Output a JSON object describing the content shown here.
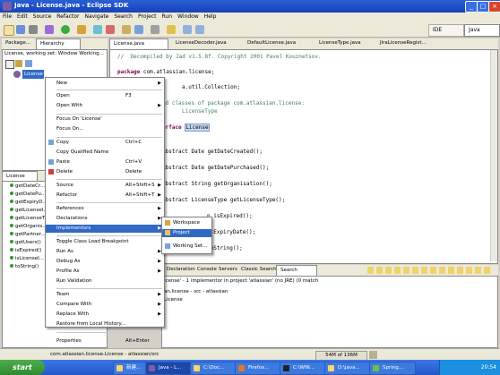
{
  "window": {
    "title": "Java - License.java - Eclipse SDK",
    "buttons": [
      "_",
      "□",
      "×"
    ]
  },
  "menubar": [
    "File",
    "Edit",
    "Source",
    "Refactor",
    "Navigate",
    "Search",
    "Project",
    "Run",
    "Window",
    "Help"
  ],
  "perspectives": {
    "ide": "IDE",
    "java": "Java"
  },
  "left_tabs": {
    "package": "Package...",
    "hierarchy": "Hierarchy"
  },
  "hierarchy": {
    "header": "License, working set: Window Working...",
    "selected_node": "License"
  },
  "outline": {
    "header_label": "License",
    "items": [
      "getDateCr...",
      "getDatePu...",
      "getExpiryD...",
      "getLicenseI...",
      "getLicenseT...",
      "getOrganis...",
      "getPartner...",
      "getUsers()",
      "isExpired()",
      "isLicenseI...",
      "toString()"
    ]
  },
  "editor_tabs": [
    "License.java",
    "LicenseDecoder.java",
    "DefaultLicense.java",
    "LicenseType.java",
    "JiraLicenseRegist..."
  ],
  "code": {
    "line1": "//  Decompiled by Jad v1.5.8f. Copyright 2001 Pavel Kouznetsov.",
    "pkg_kw": "package",
    "pkg_name": " com.atlassian.license;",
    "import_rest": "a.util.Collection;",
    "comment1": "ed classes of package com.atlassian.license:",
    "comment2": "LicenseType",
    "iface_kw": "erface",
    "iface_name": "License",
    "m1": "abstract Date getDateCreated();",
    "m2": "abstract Date getDatePurchased();",
    "m3": "abstract String getOrganisation();",
    "m4": "abstract LicenseType getLicenseType();",
    "m5": "n isExpired();",
    "m6": "etExpiryDate();",
    "m7": "toString();"
  },
  "context_menu": {
    "items": [
      {
        "label": "New",
        "acc": "",
        "arrow": true
      },
      {
        "label": "Open",
        "acc": "F3",
        "arrow": false
      },
      {
        "label": "Open With",
        "acc": "",
        "arrow": true
      },
      {
        "label": "Focus On 'License'",
        "acc": "",
        "arrow": false
      },
      {
        "label": "Focus On...",
        "acc": "",
        "arrow": false
      },
      {
        "label": "Copy",
        "acc": "Ctrl+C",
        "arrow": false
      },
      {
        "label": "Copy Qualified Name",
        "acc": "",
        "arrow": false
      },
      {
        "label": "Paste",
        "acc": "Ctrl+V",
        "arrow": false
      },
      {
        "label": "Delete",
        "acc": "Delete",
        "arrow": false
      },
      {
        "label": "Source",
        "acc": "Alt+Shift+S",
        "arrow": true
      },
      {
        "label": "Refactor",
        "acc": "Alt+Shift+T",
        "arrow": true
      },
      {
        "label": "References",
        "acc": "",
        "arrow": true
      },
      {
        "label": "Declarations",
        "acc": "",
        "arrow": true
      },
      {
        "label": "Implementors",
        "acc": "",
        "arrow": true
      },
      {
        "label": "Toggle Class Load Breakpoint",
        "acc": "",
        "arrow": false
      },
      {
        "label": "Run As",
        "acc": "",
        "arrow": true
      },
      {
        "label": "Debug As",
        "acc": "",
        "arrow": true
      },
      {
        "label": "Profile As",
        "acc": "",
        "arrow": true
      },
      {
        "label": "Run Validation",
        "acc": "",
        "arrow": false
      },
      {
        "label": "Team",
        "acc": "",
        "arrow": true
      },
      {
        "label": "Compare With",
        "acc": "",
        "arrow": true
      },
      {
        "label": "Replace With",
        "acc": "",
        "arrow": true
      },
      {
        "label": "Restore from Local History...",
        "acc": "",
        "arrow": false
      },
      {
        "label": "Properties",
        "acc": "Alt+Enter",
        "arrow": false
      }
    ]
  },
  "submenu": {
    "items": [
      "Workspace",
      "Project",
      "Working Set..."
    ]
  },
  "bottom_tabs": [
    "Declaration",
    "Console",
    "Servers",
    "Classic Search",
    "Search"
  ],
  "search": {
    "summary": "icense' - 1 implementor in project 'atlassian' (no JRE) (0 match",
    "row1": "an.license - src - atlassian",
    "row2": "License"
  },
  "status": {
    "path": "com.atlassian.license.License - atlassian/src",
    "memory": "54M of 136M"
  },
  "taskbar": {
    "start": "start",
    "tasks": [
      "新建...",
      "Java - L...",
      "C:\\Doc...",
      "Firefox...",
      "C:\\WIN...",
      "D:\\java...",
      "Spring..."
    ],
    "clock": "20:54"
  },
  "colors": {
    "title_blue": "#1f52c8",
    "selection": "#316ac5",
    "keyword": "#7f0055",
    "comment": "#3f7f5f"
  }
}
